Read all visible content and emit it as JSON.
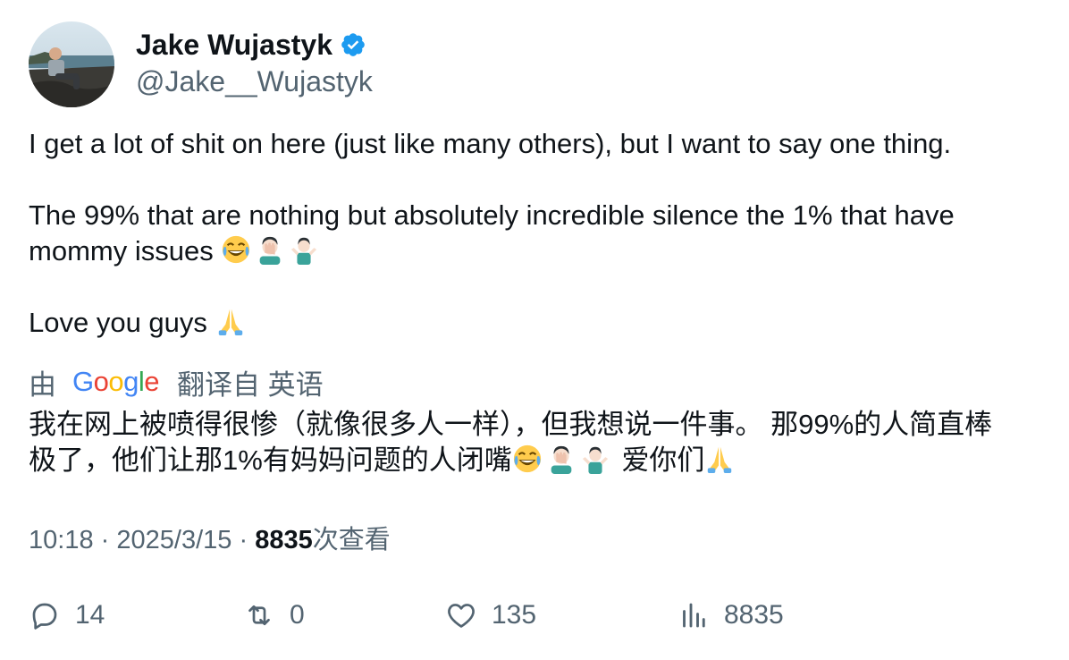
{
  "author": {
    "display_name": "Jake Wujastyk",
    "handle": "@Jake__Wujastyk",
    "verified": true
  },
  "tweet": {
    "line1": "I get a lot of shit on here (just like many others), but I want to say one thing.",
    "line2a": "The 99% that are nothing but absolutely incredible silence the 1% that have",
    "line2b": "mommy issues",
    "line3": "Love you guys",
    "emojis_line2": [
      "tears-of-joy-emoji",
      "facepalm-emoji",
      "shrug-emoji"
    ],
    "emojis_line3": [
      "folded-hands-emoji"
    ]
  },
  "translation": {
    "prefix": "由",
    "provider": "Google",
    "suffix": "翻译自 英语",
    "line1": "我在网上被喷得很惨（就像很多人一样），但我想说一件事。 那99%的人简直棒",
    "line2a": "极了，他们让那1%有妈妈问题的人闭嘴",
    "line2b": "爱你们"
  },
  "meta": {
    "time": "10:18",
    "date": "2025/3/15",
    "sep": "·",
    "views_count": "8835",
    "views_label": "次查看"
  },
  "actions": {
    "replies": "14",
    "retweets": "0",
    "likes": "135",
    "views": "8835"
  },
  "colors": {
    "text": "#0f1419",
    "secondary": "#536471",
    "verified_blue": "#1d9bf0"
  }
}
